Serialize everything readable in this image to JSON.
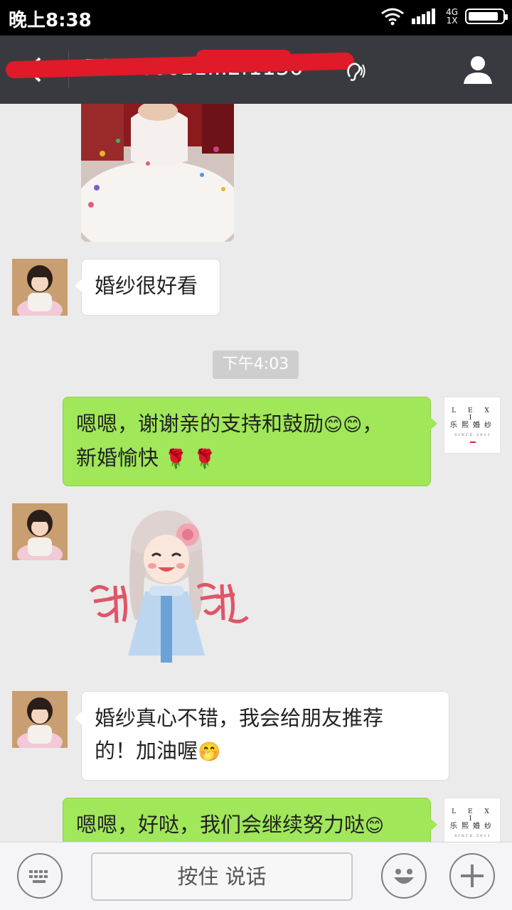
{
  "status_bar": {
    "time": "晚上8:38",
    "network_top": "4G",
    "network_bottom": "1X",
    "battery_level": 0.9
  },
  "header": {
    "title": "B17666611...2f1136",
    "bar_color": "#393a3f"
  },
  "messages": {
    "m1": {
      "text": "婚纱很好看"
    },
    "timestamp": "下午4:03",
    "m2": {
      "line1": "嗯嗯，谢谢亲的支持和鼓励",
      "line1_end": "，",
      "line2": "新婚愉快",
      "emoji": [
        "smiling-face",
        "rose"
      ]
    },
    "m3": {
      "sticker": "谢谢"
    },
    "m4": {
      "line1": "婚纱真心不错，我会给朋友推荐",
      "line2": "的！加油喔",
      "emoji": [
        "hugging-face"
      ]
    },
    "m5": {
      "line1": "嗯嗯，好哒，我们会继续努力哒",
      "emoji": [
        "smiling-face"
      ]
    }
  },
  "logo": {
    "line1": "L E X I",
    "line2": "乐熙婚纱",
    "line3": "SINCE 2011"
  },
  "input_bar": {
    "hold_to_talk": "按住 说话"
  },
  "colors": {
    "sent_bubble": "#a0e759",
    "received_bubble": "#ffffff",
    "chat_background": "#ebebeb"
  }
}
